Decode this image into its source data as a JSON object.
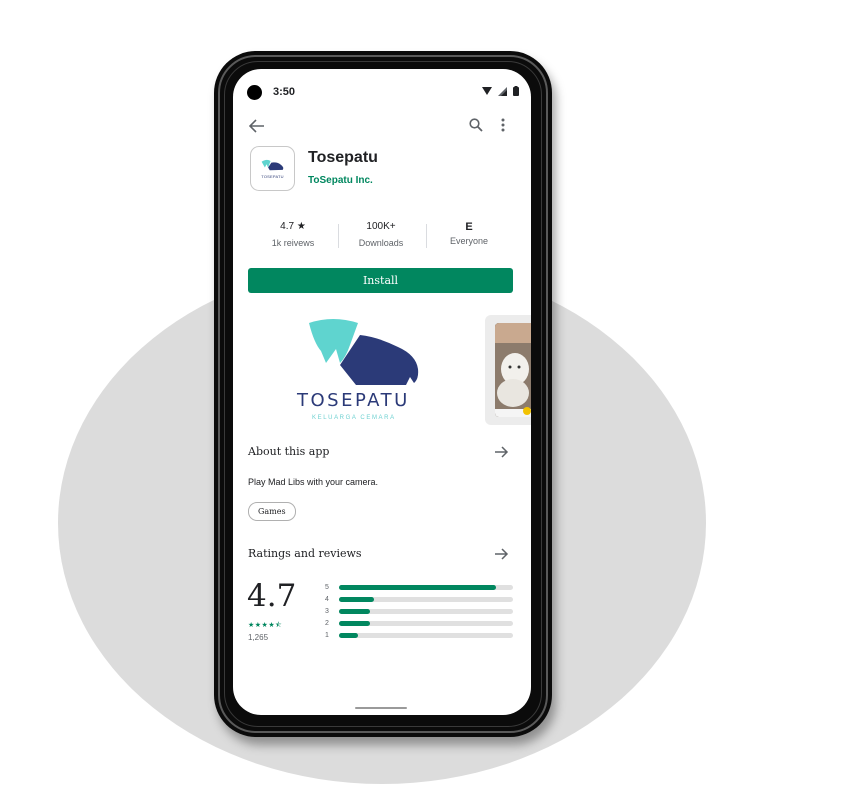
{
  "status_bar": {
    "time": "3:50"
  },
  "app": {
    "name": "Tosepatu",
    "developer": "ToSepatu Inc.",
    "icon_text": "TOSEPATU"
  },
  "stats": {
    "rating": "4.7",
    "rating_star": "★",
    "reviews": "1k reivews",
    "downloads_value": "100K+",
    "downloads_label": "Downloads",
    "content_rating_icon": "E",
    "content_rating_label": "Everyone"
  },
  "install_label": "Install",
  "hero": {
    "brand": "TOSEPATU",
    "tagline": "KELUARGA CEMARA"
  },
  "about": {
    "title": "About this app",
    "description": "Play Mad Libs with your camera.",
    "chip": "Games"
  },
  "ratings": {
    "title": "Ratings and reviews",
    "average": "4.7",
    "stars": "★★★★⯪",
    "count": "1,265",
    "bars": [
      {
        "label": "5",
        "fraction": 0.9
      },
      {
        "label": "4",
        "fraction": 0.2
      },
      {
        "label": "3",
        "fraction": 0.18
      },
      {
        "label": "2",
        "fraction": 0.18
      },
      {
        "label": "1",
        "fraction": 0.11
      }
    ]
  },
  "colors": {
    "accent": "#01875f",
    "brand_navy": "#2b3a78",
    "brand_teal": "#5fd4cf"
  },
  "icons": [
    "back-arrow-icon",
    "search-icon",
    "more-vert-icon",
    "wifi-icon",
    "signal-icon",
    "battery-icon",
    "star-icon",
    "content-rating-e-icon",
    "arrow-forward-icon"
  ]
}
